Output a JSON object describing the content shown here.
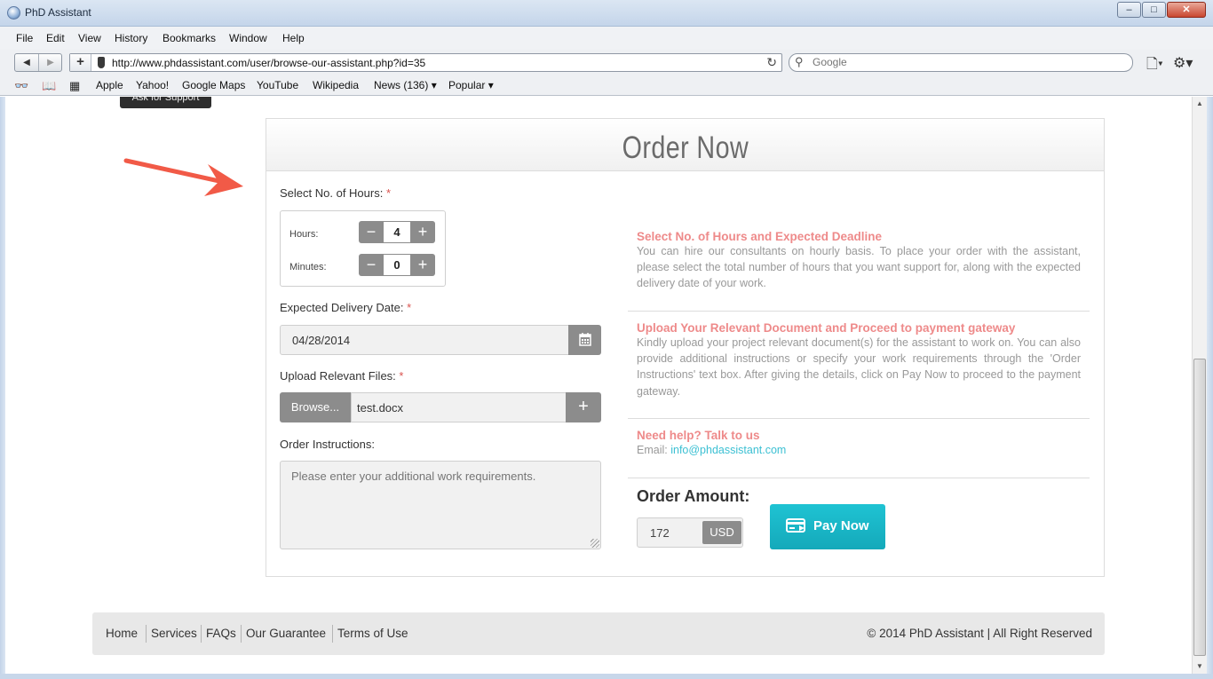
{
  "window": {
    "title": "PhD Assistant",
    "controls": {
      "minimize": "–",
      "maximize": "□",
      "close": "✕"
    }
  },
  "menu": [
    "File",
    "Edit",
    "View",
    "History",
    "Bookmarks",
    "Window",
    "Help"
  ],
  "toolbar": {
    "url": "http://www.phdassistant.com/user/browse-our-assistant.php?id=35",
    "search_placeholder": "Google"
  },
  "bookmarks": {
    "items": [
      "Apple",
      "Yahoo!",
      "Google Maps",
      "YouTube",
      "Wikipedia",
      "News (136) ▾",
      "Popular ▾"
    ]
  },
  "page": {
    "tooltip": "Ask for Support",
    "card_title": "Order Now",
    "hours_section": {
      "label": "Select No. of Hours:",
      "hours_label": "Hours:",
      "minutes_label": "Minutes:",
      "hours_value": "4",
      "minutes_value": "0"
    },
    "delivery": {
      "label": "Expected Delivery Date:",
      "value": "04/28/2014"
    },
    "upload": {
      "label": "Upload Relevant Files:",
      "browse": "Browse...",
      "filename": "test.docx"
    },
    "instructions": {
      "label": "Order Instructions:",
      "placeholder": "Please enter your additional work requirements."
    },
    "info": [
      {
        "title": "Select No. of Hours and Expected Deadline",
        "text": "You can hire our consultants on hourly basis. To place your order with the assistant, please select the total number of hours that you want support for, along with the expected delivery date of your work."
      },
      {
        "title": "Upload Your Relevant Document and Proceed to payment gateway",
        "text": "Kindly upload your project relevant document(s) for the assistant to work on. You can also provide additional instructions or specify your work requirements through the 'Order Instructions' text box. After giving the details, click on Pay Now to proceed to the payment gateway."
      }
    ],
    "help": {
      "title": "Need help? Talk to us",
      "email_label": "Email:",
      "email": "info@phdassistant.com"
    },
    "order": {
      "title": "Order Amount:",
      "amount": "172",
      "currency": "USD",
      "pay_label": "Pay Now"
    }
  },
  "footer": {
    "links": [
      "Home",
      "Services",
      "FAQs",
      "Our Guarantee",
      "Terms of Use"
    ],
    "copyright": "© 2014 PhD Assistant | All Right Reserved"
  },
  "colors": {
    "accent_pink": "#ee8a8a",
    "accent_teal": "#1bb8c9",
    "annotation_arrow": "#f15a47"
  },
  "icons": {
    "calendar": "calendar-icon",
    "pay": "credit-card-icon"
  }
}
